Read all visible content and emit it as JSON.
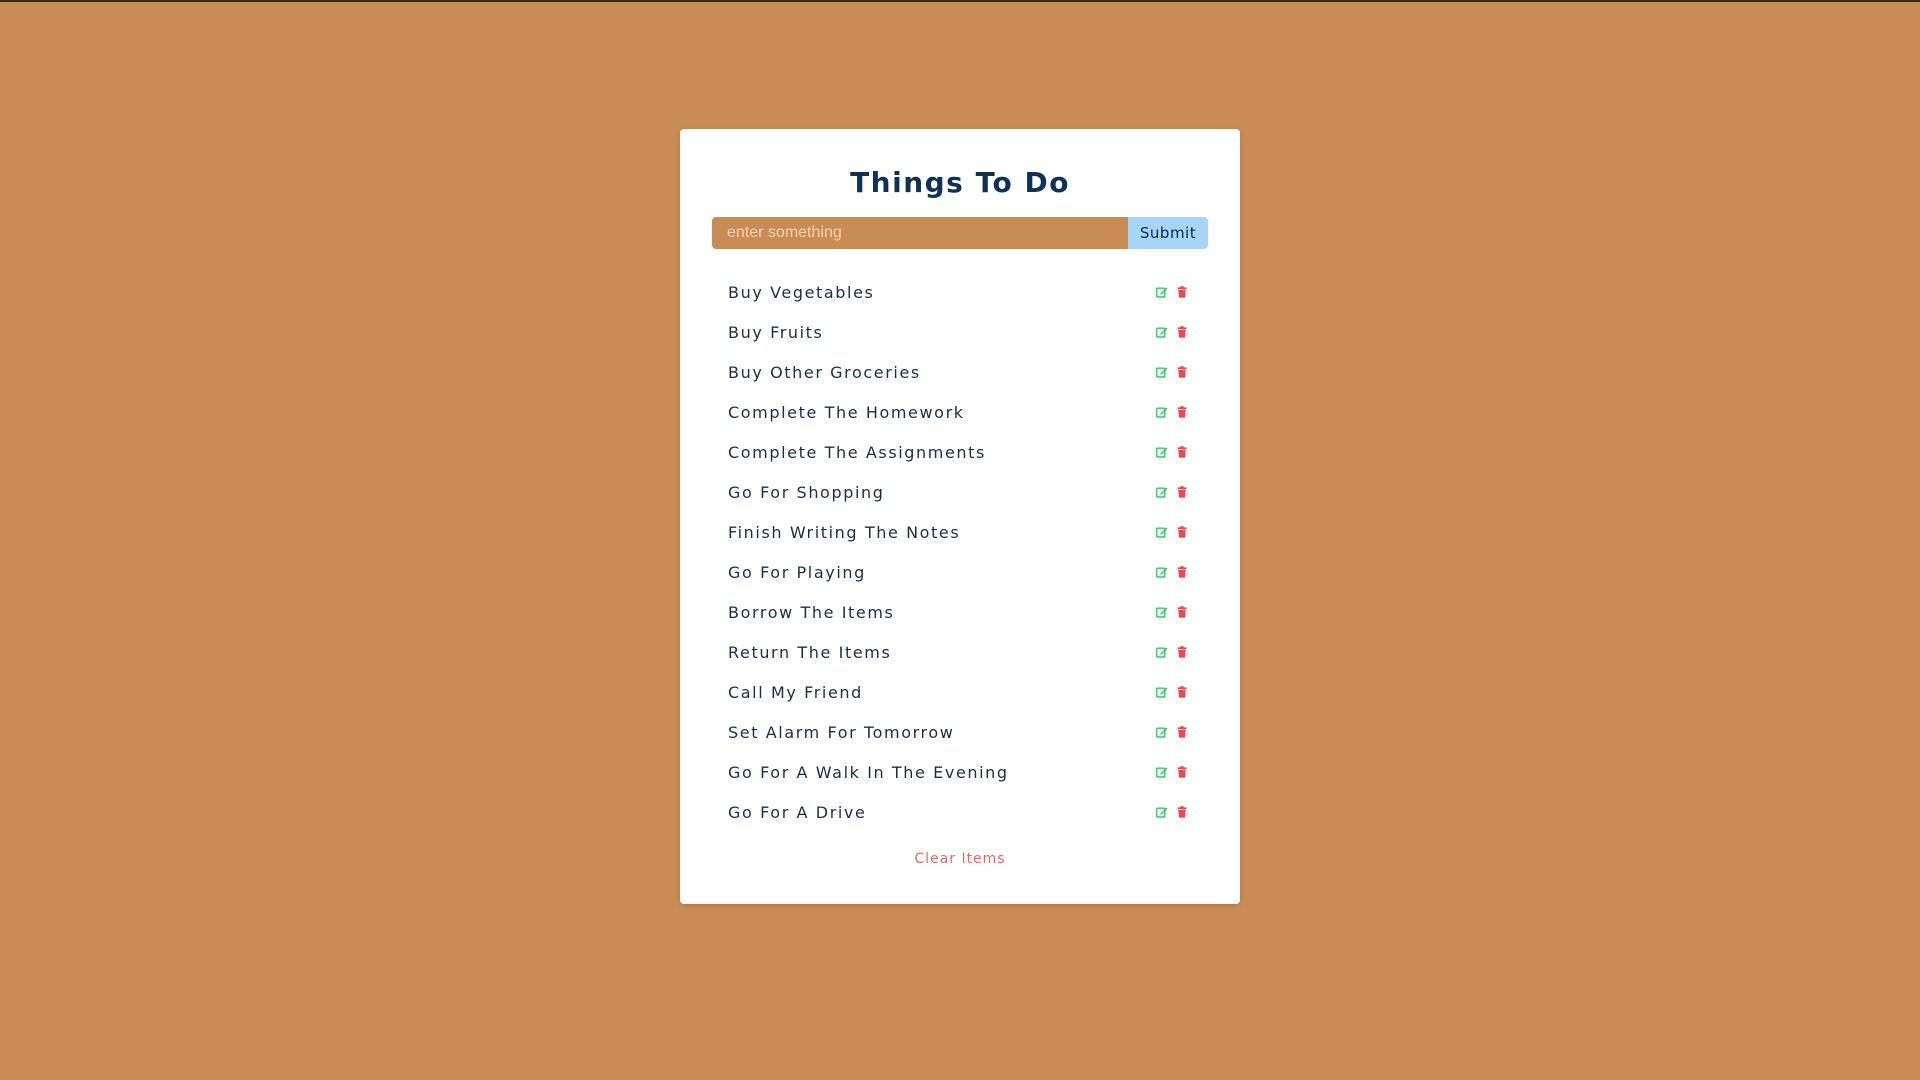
{
  "app": {
    "title": "Things To Do"
  },
  "form": {
    "placeholder": "enter something",
    "value": "",
    "submit_label": "Submit"
  },
  "items": [
    {
      "label": "Buy Vegetables"
    },
    {
      "label": "Buy Fruits"
    },
    {
      "label": "Buy Other Groceries"
    },
    {
      "label": "Complete The Homework"
    },
    {
      "label": "Complete The Assignments"
    },
    {
      "label": "Go For Shopping"
    },
    {
      "label": "Finish Writing The Notes"
    },
    {
      "label": "Go For Playing"
    },
    {
      "label": "Borrow The Items"
    },
    {
      "label": "Return The Items"
    },
    {
      "label": "Call My Friend"
    },
    {
      "label": "Set Alarm For Tomorrow"
    },
    {
      "label": "Go For A Walk In The Evening"
    },
    {
      "label": "Go For A Drive"
    }
  ],
  "item_actions": {
    "edit_icon": "edit-icon",
    "delete_icon": "trash-icon"
  },
  "footer": {
    "clear_label": "Clear Items"
  },
  "colors": {
    "background": "#c98c55",
    "card": "#ffffff",
    "title": "#0d3256",
    "submit_bg": "#a8d4f5",
    "edit": "#3cc46a",
    "delete": "#e34d4d",
    "clear": "#e46a6a"
  }
}
